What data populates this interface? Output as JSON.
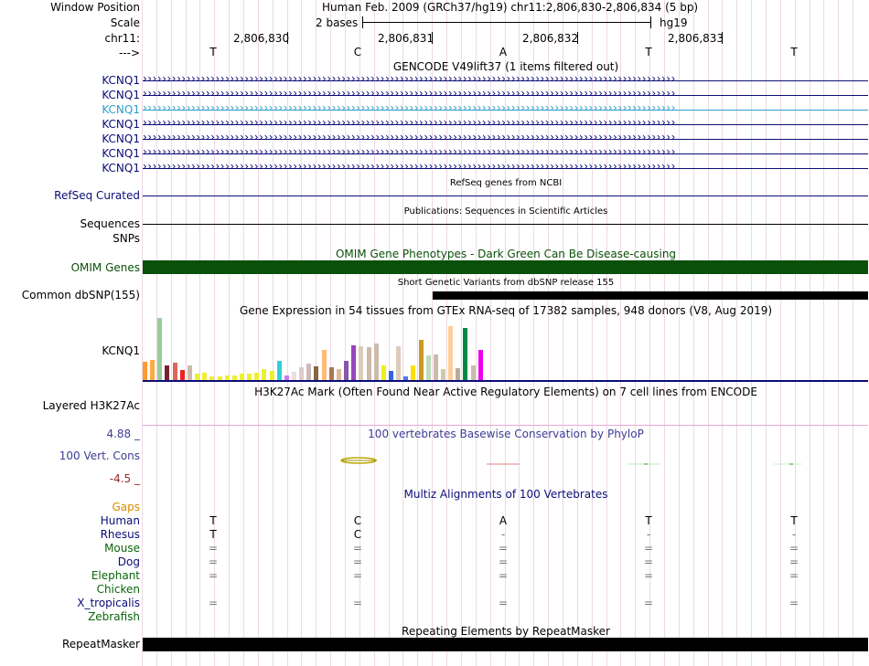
{
  "header": {
    "window_position_label": "Window Position",
    "title": "Human Feb. 2009 (GRCh37/hg19)   chr11:2,806,830-2,806,834 (5 bp)",
    "scale_label": "Scale",
    "scale_text": "2 bases",
    "assembly": "hg19",
    "chrom_label": "chr11:",
    "positions": [
      "2,806,830",
      "2,806,831",
      "2,806,832",
      "2,806,833"
    ],
    "strand_label": "--->",
    "bases": [
      "T",
      "C",
      "A",
      "T",
      "T"
    ]
  },
  "gencode": {
    "title": "GENCODE V49lift37 (1 items filtered out)",
    "items": [
      "KCNQ1",
      "KCNQ1",
      "KCNQ1",
      "KCNQ1",
      "KCNQ1",
      "KCNQ1",
      "KCNQ1"
    ],
    "highlight_color": "#2e9ec8",
    "default_color": "#0c0c78"
  },
  "refseq": {
    "title": "RefSeq genes from NCBI",
    "label": "RefSeq Curated"
  },
  "publications": {
    "title": "Publications: Sequences in Scientific Articles",
    "label": "Sequences"
  },
  "snps_label": "SNPs",
  "omim": {
    "title": "OMIM Gene Phenotypes - Dark Green Can Be Disease-causing",
    "label": "OMIM Genes",
    "color": "#0a500a"
  },
  "dbsnp": {
    "title": "Short Genetic Variants from dbSNP release 155",
    "label": "Common dbSNP(155)"
  },
  "gtex": {
    "title": "Gene Expression in 54 tissues from GTEx RNA-seq of 17382 samples, 948 donors (V8, Aug 2019)",
    "label": "KCNQ1",
    "bars": [
      {
        "v": 0.3,
        "c": "#ff9933"
      },
      {
        "v": 0.33,
        "c": "#ffaa44"
      },
      {
        "v": 1.0,
        "c": "#99cc99"
      },
      {
        "v": 0.24,
        "c": "#772233"
      },
      {
        "v": 0.28,
        "c": "#dd6655"
      },
      {
        "v": 0.16,
        "c": "#ee2222"
      },
      {
        "v": 0.24,
        "c": "#ccbbaa"
      },
      {
        "v": 0.1,
        "c": "#eeee33"
      },
      {
        "v": 0.12,
        "c": "#eeee33"
      },
      {
        "v": 0.06,
        "c": "#eeee33"
      },
      {
        "v": 0.06,
        "c": "#eeee33"
      },
      {
        "v": 0.08,
        "c": "#eeee33"
      },
      {
        "v": 0.08,
        "c": "#eeee33"
      },
      {
        "v": 0.1,
        "c": "#eeee33"
      },
      {
        "v": 0.1,
        "c": "#eeee33"
      },
      {
        "v": 0.12,
        "c": "#eeee33"
      },
      {
        "v": 0.17,
        "c": "#eeee33"
      },
      {
        "v": 0.14,
        "c": "#eeee33"
      },
      {
        "v": 0.31,
        "c": "#33ccdd"
      },
      {
        "v": 0.07,
        "c": "#cc77ee"
      },
      {
        "v": 0.13,
        "c": "#eedddd"
      },
      {
        "v": 0.2,
        "c": "#ddcccc"
      },
      {
        "v": 0.26,
        "c": "#ccbbbb"
      },
      {
        "v": 0.22,
        "c": "#886644"
      },
      {
        "v": 0.49,
        "c": "#ffbb77"
      },
      {
        "v": 0.2,
        "c": "#aa7755"
      },
      {
        "v": 0.17,
        "c": "#ddbb99"
      },
      {
        "v": 0.31,
        "c": "#8855aa"
      },
      {
        "v": 0.56,
        "c": "#9944bb"
      },
      {
        "v": 0.55,
        "c": "#ddccbb"
      },
      {
        "v": 0.53,
        "c": "#ccbbaa"
      },
      {
        "v": 0.59,
        "c": "#ccbbaa"
      },
      {
        "v": 0.24,
        "c": "#eeee22"
      },
      {
        "v": 0.14,
        "c": "#3366dd"
      },
      {
        "v": 0.55,
        "c": "#ddccbb"
      },
      {
        "v": 0.06,
        "c": "#5577ee"
      },
      {
        "v": 0.24,
        "c": "#ffdd00"
      },
      {
        "v": 0.64,
        "c": "#cc9922"
      },
      {
        "v": 0.4,
        "c": "#bbddbb"
      },
      {
        "v": 0.41,
        "c": "#ccbbaa"
      },
      {
        "v": 0.17,
        "c": "#ccccaa"
      },
      {
        "v": 0.87,
        "c": "#ffcc99"
      },
      {
        "v": 0.19,
        "c": "#bbaa99"
      },
      {
        "v": 0.84,
        "c": "#008844"
      },
      {
        "v": 0.24,
        "c": "#ccbbaa"
      },
      {
        "v": 0.48,
        "c": "#ee00ee"
      }
    ]
  },
  "h3k27ac": {
    "title": "H3K27Ac Mark (Often Found Near Active Regulatory Elements) on 7 cell lines from ENCODE",
    "label": "Layered H3K27Ac"
  },
  "phylop": {
    "title": "100 vertebrates Basewise Conservation by PhyloP",
    "label": "100 Vert. Cons",
    "max": "4.88 _",
    "min": "-4.5 _",
    "title_color": "#3c3c96",
    "max_color": "#3c3c96",
    "min_color": "#962828"
  },
  "multiz": {
    "title": "Multiz Alignments of 100 Vertebrates",
    "gaps_label": "Gaps",
    "species": [
      {
        "name": "Human",
        "color": "#0c0c78",
        "cells": [
          "T",
          "C",
          "A",
          "T",
          "T"
        ]
      },
      {
        "name": "Rhesus",
        "color": "#0c0c78",
        "cells": [
          "T",
          "C",
          "-",
          "-",
          "-"
        ]
      },
      {
        "name": "Mouse",
        "color": "#0a640a",
        "cells": [
          "=",
          "=",
          "=",
          "=",
          "="
        ]
      },
      {
        "name": "Dog",
        "color": "#0c0c78",
        "cells": [
          "=",
          "=",
          "=",
          "=",
          "="
        ]
      },
      {
        "name": "Elephant",
        "color": "#0a640a",
        "cells": [
          "=",
          "=",
          "=",
          "=",
          "="
        ]
      },
      {
        "name": "Chicken",
        "color": "#0a640a",
        "cells": [
          "",
          "",
          "",
          "",
          ""
        ]
      },
      {
        "name": "X_tropicalis",
        "color": "#0c0c78",
        "cells": [
          "=",
          "=",
          "=",
          "=",
          "="
        ]
      },
      {
        "name": "Zebrafish",
        "color": "#0a640a",
        "cells": [
          "",
          "",
          "",
          "",
          ""
        ]
      }
    ]
  },
  "repeatmasker": {
    "title": "Repeating Elements by RepeatMasker",
    "label": "RepeatMasker"
  }
}
